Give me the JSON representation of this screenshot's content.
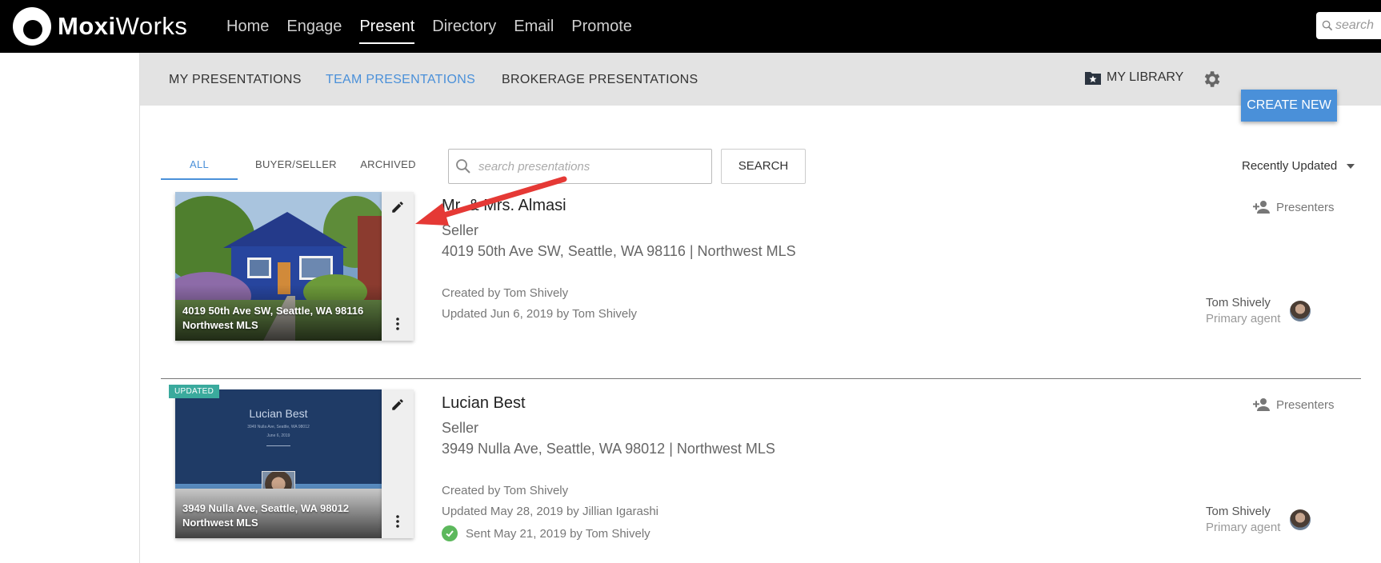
{
  "header": {
    "logo_bold": "Moxi",
    "logo_light": "Works",
    "nav": [
      {
        "label": "Home",
        "active": false
      },
      {
        "label": "Engage",
        "active": false
      },
      {
        "label": "Present",
        "active": true
      },
      {
        "label": "Directory",
        "active": false
      },
      {
        "label": "Email",
        "active": false
      },
      {
        "label": "Promote",
        "active": false
      }
    ],
    "search_placeholder": "search"
  },
  "subnav": {
    "tabs": [
      {
        "label": "MY PRESENTATIONS",
        "active": false
      },
      {
        "label": "TEAM PRESENTATIONS",
        "active": true
      },
      {
        "label": "BROKERAGE PRESENTATIONS",
        "active": false
      }
    ],
    "library_label": "MY LIBRARY",
    "create_label": "CREATE NEW"
  },
  "filters": {
    "tabs": [
      {
        "label": "ALL",
        "active": true
      },
      {
        "label": "BUYER/SELLER",
        "active": false
      },
      {
        "label": "ARCHIVED",
        "active": false
      }
    ],
    "search_placeholder": "search presentations",
    "search_button": "SEARCH",
    "sort_label": "Recently Updated"
  },
  "presentations": [
    {
      "badge": "",
      "thumb_line1": "4019 50th Ave SW, Seattle, WA 98116",
      "thumb_line2": "Northwest MLS",
      "title": "Mr. & Mrs. Almasi",
      "type": "Seller",
      "address": "4019 50th Ave SW, Seattle, WA 98116 | Northwest MLS",
      "created": "Created by Tom Shively",
      "updated": "Updated Jun 6, 2019 by Tom Shively",
      "sent": "",
      "presenters_label": "Presenters",
      "agent_name": "Tom Shively",
      "agent_role": "Primary agent"
    },
    {
      "badge": "UPDATED",
      "thumb_line1": "3949 Nulla Ave, Seattle, WA 98012",
      "thumb_line2": "Northwest MLS",
      "cover_title": "Lucian Best",
      "cover_address": "3949 Nulla Ave, Seattle, WA 98012",
      "cover_date": "June 6, 2019",
      "title": "Lucian Best",
      "type": "Seller",
      "address": "3949 Nulla Ave, Seattle, WA 98012 | Northwest MLS",
      "created": "Created by Tom Shively",
      "updated": "Updated May 28, 2019 by Jillian Igarashi",
      "sent": "Sent May 21, 2019 by Tom Shively",
      "presenters_label": "Presenters",
      "agent_name": "Tom Shively",
      "agent_role": "Primary agent"
    }
  ],
  "colors": {
    "accent": "#4a90d9",
    "badge": "#3aaa9d",
    "annotation_arrow": "#e53935"
  }
}
